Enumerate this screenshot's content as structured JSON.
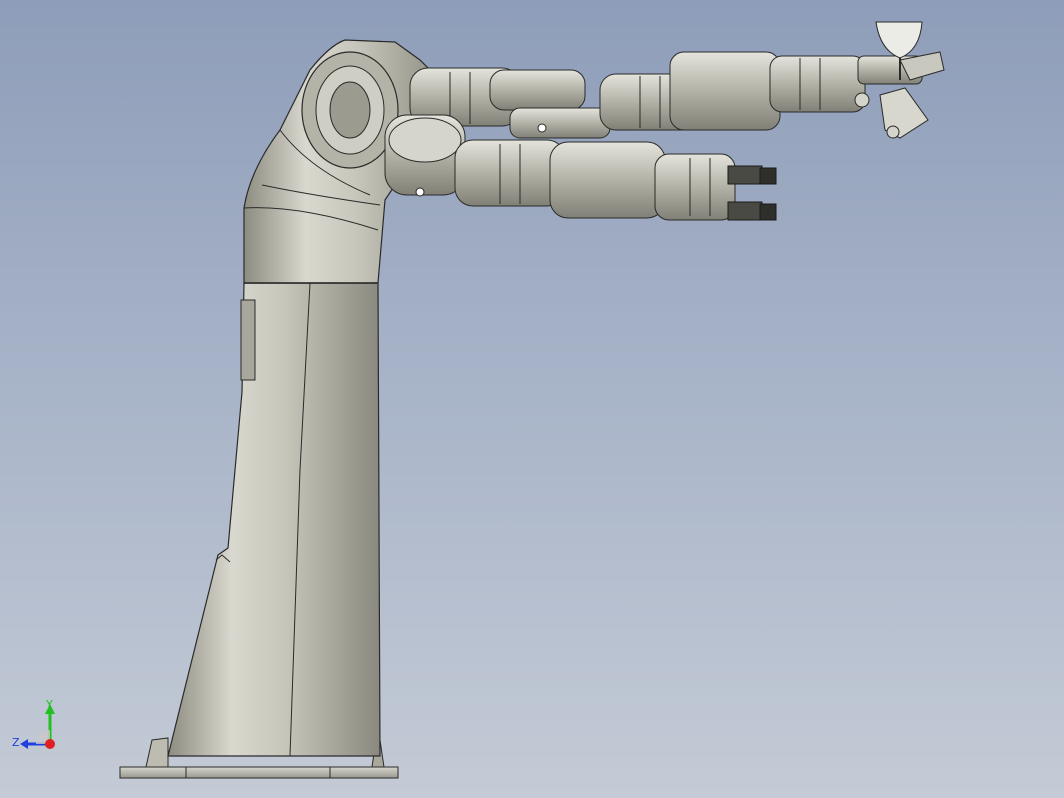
{
  "colors": {
    "background_top": "#8e9db9",
    "background_bottom": "#c4cbd6",
    "metal_light": "#e2e2da",
    "metal_mid": "#b9b8ad",
    "metal_dark": "#7e7d73",
    "edge": "#2a2a2a",
    "axis_x": "#e02020",
    "axis_y": "#20c020",
    "axis_z": "#2040e0"
  },
  "viewport": {
    "model_name": "dual-arm-robot-3d-model",
    "triad": {
      "x_label": "",
      "y_label": "Y",
      "z_label": "Z"
    }
  }
}
